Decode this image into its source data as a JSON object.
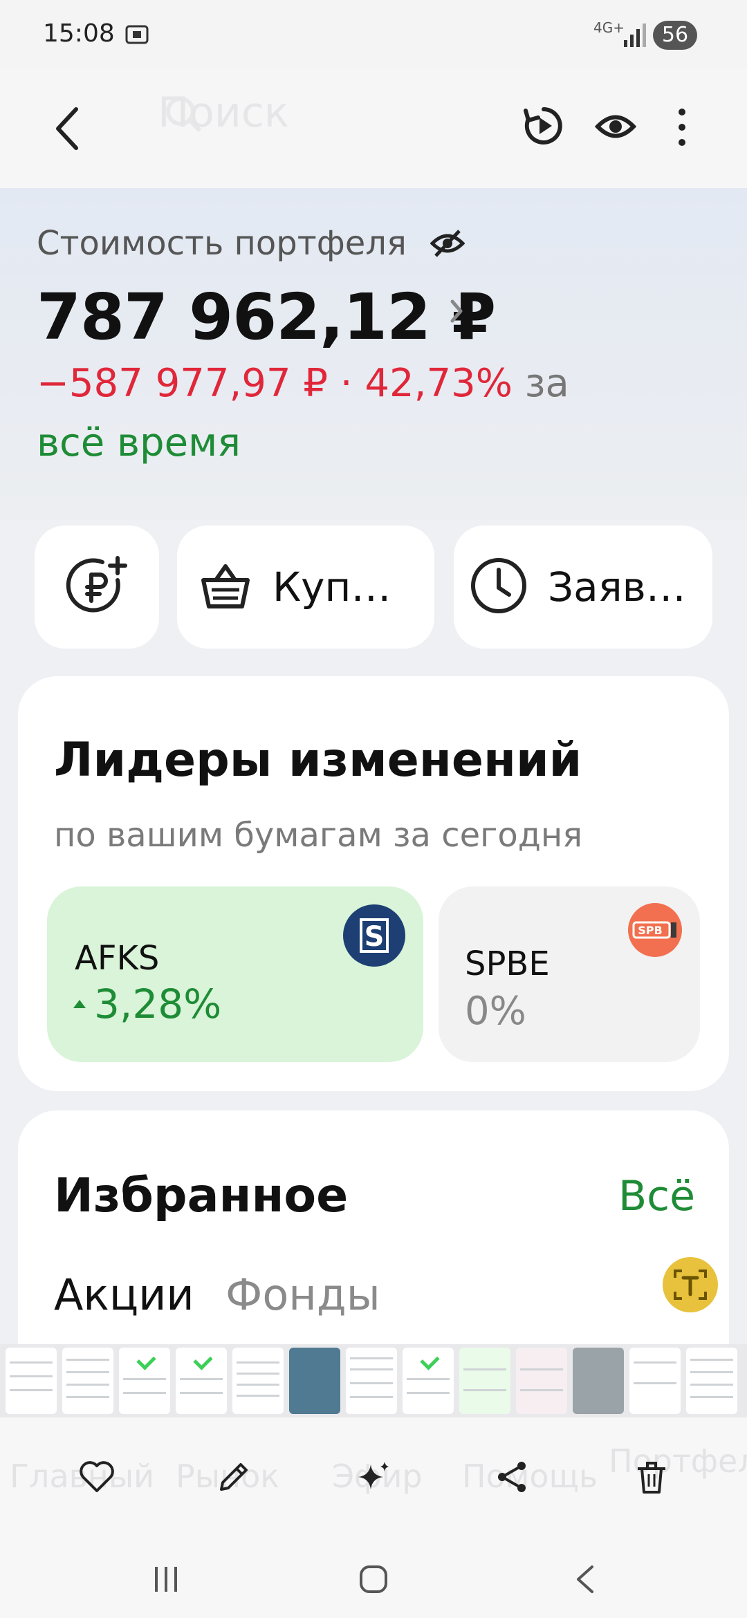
{
  "status_bar": {
    "time": "15:08",
    "network": "4G+",
    "battery": "56"
  },
  "app_bar": {
    "search_placeholder": "Поиск"
  },
  "portfolio": {
    "label": "Стоимость портфеля",
    "value": "787 962,12 ₽",
    "change_amount": "−587 977,97 ₽ · 42,73%",
    "change_suffix": "за",
    "period": "всё время"
  },
  "quick_actions": {
    "buy_label": "Куп…",
    "orders_label": "Заяв…"
  },
  "leaders": {
    "title": "Лидеры изменений",
    "subtitle": "по вашим бумагам за сегодня",
    "items": [
      {
        "ticker": "AFKS",
        "change": "3,28%",
        "direction": "up",
        "logo": "S"
      },
      {
        "ticker": "SPBE",
        "change": "0%",
        "logo": "SPB"
      }
    ]
  },
  "favorites": {
    "title": "Избранное",
    "all_label": "Всё",
    "tabs": [
      "Акции",
      "Фонды"
    ]
  },
  "background_nav": {
    "items": [
      "Главный",
      "Рынок",
      "Эфир",
      "Помощь",
      "Портфель"
    ]
  },
  "colors": {
    "green": "#1e8c36",
    "red": "#e0273a",
    "afks_tile": "#d9f4d8",
    "afks_logo": "#1d3f73",
    "spbe_logo": "#f2704f"
  }
}
